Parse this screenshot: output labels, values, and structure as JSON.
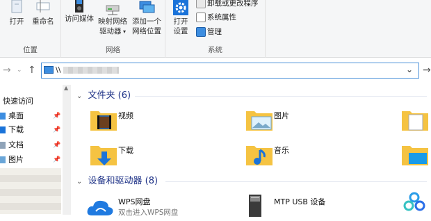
{
  "ribbon": {
    "location_group": {
      "label": "位置",
      "open": "打开",
      "rename": "重命名"
    },
    "network_group": {
      "label": "网络",
      "access_media": "访问媒体",
      "map_drive_line1": "映射网络",
      "map_drive_line2": "驱动器",
      "add_location_line1": "添加一个",
      "add_location_line2": "网络位置"
    },
    "system_group": {
      "label": "系统",
      "open_settings_line1": "打开",
      "open_settings_line2": "设置",
      "uninstall": "卸载或更改程序",
      "system_props": "系统属性",
      "manage": "管理"
    }
  },
  "address": {
    "prefix": "\\\\"
  },
  "nav": {
    "quick_access": "快速访问",
    "items": [
      {
        "label": "桌面"
      },
      {
        "label": "下载"
      },
      {
        "label": "文档"
      },
      {
        "label": "图片"
      }
    ]
  },
  "main": {
    "folders_header": "文件夹 (6)",
    "folders": [
      {
        "label": "视频"
      },
      {
        "label": "图片"
      },
      {
        "label": "下载"
      },
      {
        "label": "音乐"
      }
    ],
    "devices_header": "设备和驱动器 (8)",
    "devices": [
      {
        "label": "WPS网盘",
        "sub": "双击进入WPS网盘"
      },
      {
        "label": "MTP USB 设备",
        "sub": ""
      }
    ]
  },
  "colors": {
    "accent": "#1e3287",
    "folder": "#f5c342",
    "address_border": "#4a90d9"
  }
}
